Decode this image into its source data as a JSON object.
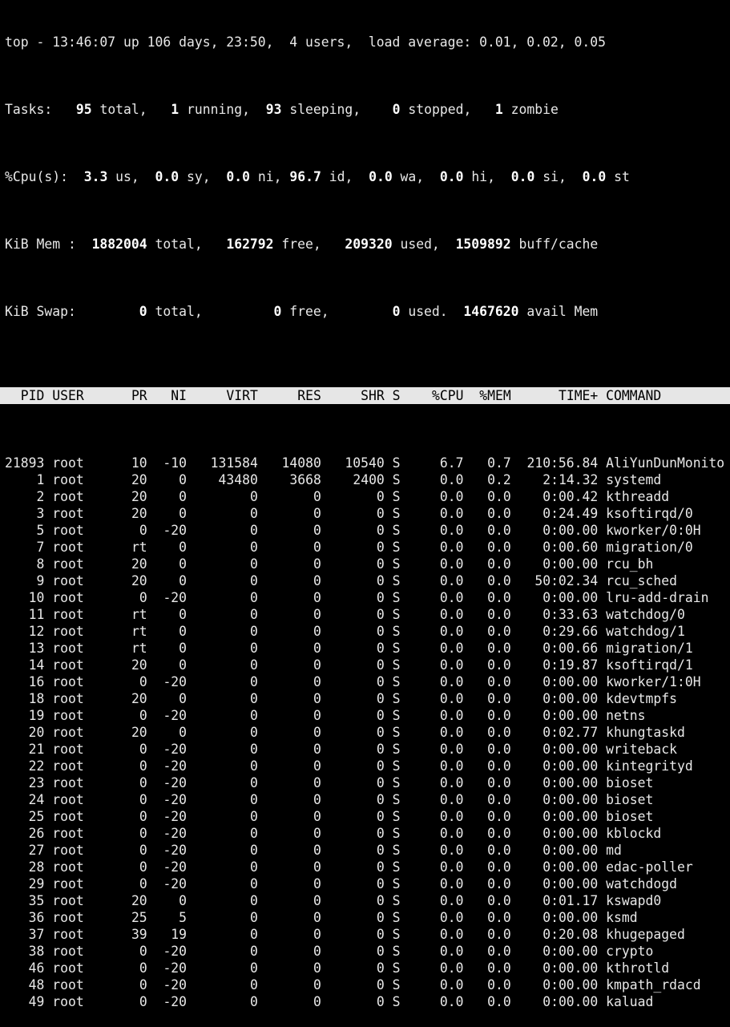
{
  "summary": {
    "uptime": {
      "prefix": "top - 13:46:07 up 106 days, 23:50,  4 users,  load average: 0.01, 0.02, 0.05"
    },
    "tasks": {
      "label": "Tasks:",
      "total": "95",
      "total_label": " total,",
      "running": "1",
      "running_label": " running,",
      "sleeping": "93",
      "sleeping_label": " sleeping,",
      "stopped": "0",
      "stopped_label": " stopped,",
      "zombie": "1",
      "zombie_label": " zombie"
    },
    "cpu": {
      "label": "%Cpu(s):",
      "us": "3.3",
      "us_label": " us,",
      "sy": "0.0",
      "sy_label": " sy,",
      "ni": "0.0",
      "ni_label": " ni,",
      "id": "96.7",
      "id_label": " id,",
      "wa": "0.0",
      "wa_label": " wa,",
      "hi": "0.0",
      "hi_label": " hi,",
      "si": "0.0",
      "si_label": " si,",
      "st": "0.0",
      "st_label": " st"
    },
    "mem": {
      "label": "KiB Mem :",
      "total": "1882004",
      "total_label": " total,",
      "free": "162792",
      "free_label": " free,",
      "used": "209320",
      "used_label": " used,",
      "cache": "1509892",
      "cache_label": " buff/cache"
    },
    "swap": {
      "label": "KiB Swap:",
      "total": "0",
      "total_label": " total,",
      "free": "0",
      "free_label": " free,",
      "used": "0",
      "used_label": " used.",
      "avail": "1467620",
      "avail_label": " avail Mem"
    }
  },
  "table": {
    "columns": [
      "PID",
      "USER",
      "PR",
      "NI",
      "VIRT",
      "RES",
      "SHR",
      "S",
      "%CPU",
      "%MEM",
      "TIME+",
      "COMMAND"
    ],
    "rows": [
      [
        "21893",
        "root",
        "10",
        "-10",
        "131584",
        "14080",
        "10540",
        "S",
        "6.7",
        "0.7",
        "210:56.84",
        "AliYunDunMonito"
      ],
      [
        "1",
        "root",
        "20",
        "0",
        "43480",
        "3668",
        "2400",
        "S",
        "0.0",
        "0.2",
        "2:14.32",
        "systemd"
      ],
      [
        "2",
        "root",
        "20",
        "0",
        "0",
        "0",
        "0",
        "S",
        "0.0",
        "0.0",
        "0:00.42",
        "kthreadd"
      ],
      [
        "3",
        "root",
        "20",
        "0",
        "0",
        "0",
        "0",
        "S",
        "0.0",
        "0.0",
        "0:24.49",
        "ksoftirqd/0"
      ],
      [
        "5",
        "root",
        "0",
        "-20",
        "0",
        "0",
        "0",
        "S",
        "0.0",
        "0.0",
        "0:00.00",
        "kworker/0:0H"
      ],
      [
        "7",
        "root",
        "rt",
        "0",
        "0",
        "0",
        "0",
        "S",
        "0.0",
        "0.0",
        "0:00.60",
        "migration/0"
      ],
      [
        "8",
        "root",
        "20",
        "0",
        "0",
        "0",
        "0",
        "S",
        "0.0",
        "0.0",
        "0:00.00",
        "rcu_bh"
      ],
      [
        "9",
        "root",
        "20",
        "0",
        "0",
        "0",
        "0",
        "S",
        "0.0",
        "0.0",
        "50:02.34",
        "rcu_sched"
      ],
      [
        "10",
        "root",
        "0",
        "-20",
        "0",
        "0",
        "0",
        "S",
        "0.0",
        "0.0",
        "0:00.00",
        "lru-add-drain"
      ],
      [
        "11",
        "root",
        "rt",
        "0",
        "0",
        "0",
        "0",
        "S",
        "0.0",
        "0.0",
        "0:33.63",
        "watchdog/0"
      ],
      [
        "12",
        "root",
        "rt",
        "0",
        "0",
        "0",
        "0",
        "S",
        "0.0",
        "0.0",
        "0:29.66",
        "watchdog/1"
      ],
      [
        "13",
        "root",
        "rt",
        "0",
        "0",
        "0",
        "0",
        "S",
        "0.0",
        "0.0",
        "0:00.66",
        "migration/1"
      ],
      [
        "14",
        "root",
        "20",
        "0",
        "0",
        "0",
        "0",
        "S",
        "0.0",
        "0.0",
        "0:19.87",
        "ksoftirqd/1"
      ],
      [
        "16",
        "root",
        "0",
        "-20",
        "0",
        "0",
        "0",
        "S",
        "0.0",
        "0.0",
        "0:00.00",
        "kworker/1:0H"
      ],
      [
        "18",
        "root",
        "20",
        "0",
        "0",
        "0",
        "0",
        "S",
        "0.0",
        "0.0",
        "0:00.00",
        "kdevtmpfs"
      ],
      [
        "19",
        "root",
        "0",
        "-20",
        "0",
        "0",
        "0",
        "S",
        "0.0",
        "0.0",
        "0:00.00",
        "netns"
      ],
      [
        "20",
        "root",
        "20",
        "0",
        "0",
        "0",
        "0",
        "S",
        "0.0",
        "0.0",
        "0:02.77",
        "khungtaskd"
      ],
      [
        "21",
        "root",
        "0",
        "-20",
        "0",
        "0",
        "0",
        "S",
        "0.0",
        "0.0",
        "0:00.00",
        "writeback"
      ],
      [
        "22",
        "root",
        "0",
        "-20",
        "0",
        "0",
        "0",
        "S",
        "0.0",
        "0.0",
        "0:00.00",
        "kintegrityd"
      ],
      [
        "23",
        "root",
        "0",
        "-20",
        "0",
        "0",
        "0",
        "S",
        "0.0",
        "0.0",
        "0:00.00",
        "bioset"
      ],
      [
        "24",
        "root",
        "0",
        "-20",
        "0",
        "0",
        "0",
        "S",
        "0.0",
        "0.0",
        "0:00.00",
        "bioset"
      ],
      [
        "25",
        "root",
        "0",
        "-20",
        "0",
        "0",
        "0",
        "S",
        "0.0",
        "0.0",
        "0:00.00",
        "bioset"
      ],
      [
        "26",
        "root",
        "0",
        "-20",
        "0",
        "0",
        "0",
        "S",
        "0.0",
        "0.0",
        "0:00.00",
        "kblockd"
      ],
      [
        "27",
        "root",
        "0",
        "-20",
        "0",
        "0",
        "0",
        "S",
        "0.0",
        "0.0",
        "0:00.00",
        "md"
      ],
      [
        "28",
        "root",
        "0",
        "-20",
        "0",
        "0",
        "0",
        "S",
        "0.0",
        "0.0",
        "0:00.00",
        "edac-poller"
      ],
      [
        "29",
        "root",
        "0",
        "-20",
        "0",
        "0",
        "0",
        "S",
        "0.0",
        "0.0",
        "0:00.00",
        "watchdogd"
      ],
      [
        "35",
        "root",
        "20",
        "0",
        "0",
        "0",
        "0",
        "S",
        "0.0",
        "0.0",
        "0:01.17",
        "kswapd0"
      ],
      [
        "36",
        "root",
        "25",
        "5",
        "0",
        "0",
        "0",
        "S",
        "0.0",
        "0.0",
        "0:00.00",
        "ksmd"
      ],
      [
        "37",
        "root",
        "39",
        "19",
        "0",
        "0",
        "0",
        "S",
        "0.0",
        "0.0",
        "0:20.08",
        "khugepaged"
      ],
      [
        "38",
        "root",
        "0",
        "-20",
        "0",
        "0",
        "0",
        "S",
        "0.0",
        "0.0",
        "0:00.00",
        "crypto"
      ],
      [
        "46",
        "root",
        "0",
        "-20",
        "0",
        "0",
        "0",
        "S",
        "0.0",
        "0.0",
        "0:00.00",
        "kthrotld"
      ],
      [
        "48",
        "root",
        "0",
        "-20",
        "0",
        "0",
        "0",
        "S",
        "0.0",
        "0.0",
        "0:00.00",
        "kmpath_rdacd"
      ],
      [
        "49",
        "root",
        "0",
        "-20",
        "0",
        "0",
        "0",
        "S",
        "0.0",
        "0.0",
        "0:00.00",
        "kaluad"
      ]
    ]
  },
  "colors": {
    "background": "#000000",
    "text": "#e8e8e8",
    "bold_text": "#ffffff",
    "header_bg": "#e6e6e6",
    "header_text": "#000000"
  }
}
